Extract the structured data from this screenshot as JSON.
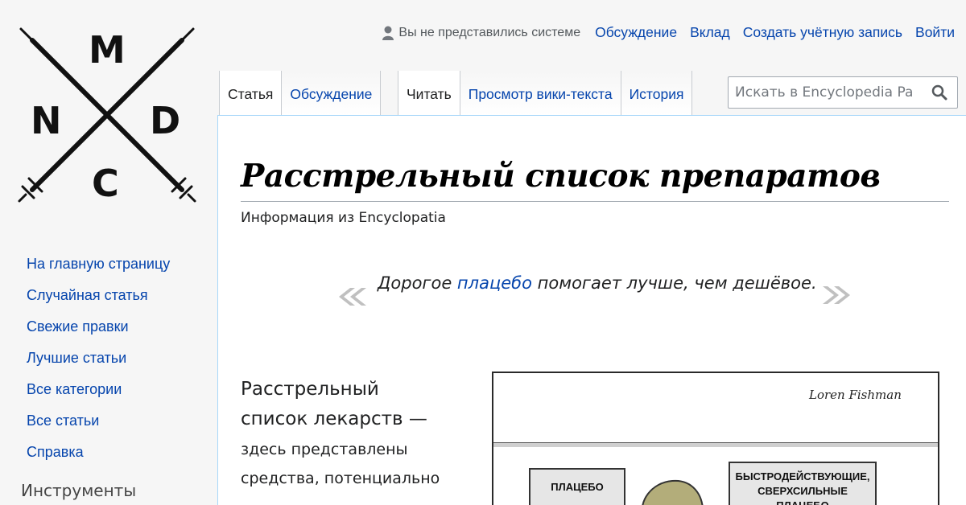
{
  "logo": {
    "letters": [
      "M",
      "N",
      "D",
      "C"
    ],
    "icon": "crossed-syringes-logo"
  },
  "personal_tools": {
    "anon_text": "Вы не представились системе",
    "links": [
      "Обсуждение",
      "Вклад",
      "Создать учётную запись",
      "Войти"
    ]
  },
  "tabs": {
    "left": [
      "Статья",
      "Обсуждение"
    ],
    "right": [
      "Читать",
      "Просмотр вики-текста",
      "История"
    ]
  },
  "search": {
    "placeholder": "Искать в Encyclopedia Pa",
    "icon": "search-icon"
  },
  "sidebar": {
    "nav": [
      "На главную страницу",
      "Случайная статья",
      "Свежие правки",
      "Лучшие статьи",
      "Все категории",
      "Все статьи",
      "Справка"
    ],
    "tools_heading": "Инструменты"
  },
  "article": {
    "title": "Расстрельный список препаратов",
    "subtitle": "Информация из Encyclopatia",
    "quote": {
      "before": "Дорогое ",
      "link": "плацебо",
      "after": " помогает лучше, чем дешёвое."
    },
    "intro": {
      "line1": "Расстрельный",
      "line2": "список лекарств —",
      "line3": "здесь представлены",
      "line4": "средства, потенциально"
    },
    "comic": {
      "signature": "Loren Fishman",
      "label_left": "ПЛАЦЕБО",
      "label_right_1": "БЫСТРОДЕЙСТВУЮЩИЕ,",
      "label_right_2": "СВЕРХСИЛЬНЫЕ ПЛАЦЕБО"
    }
  }
}
